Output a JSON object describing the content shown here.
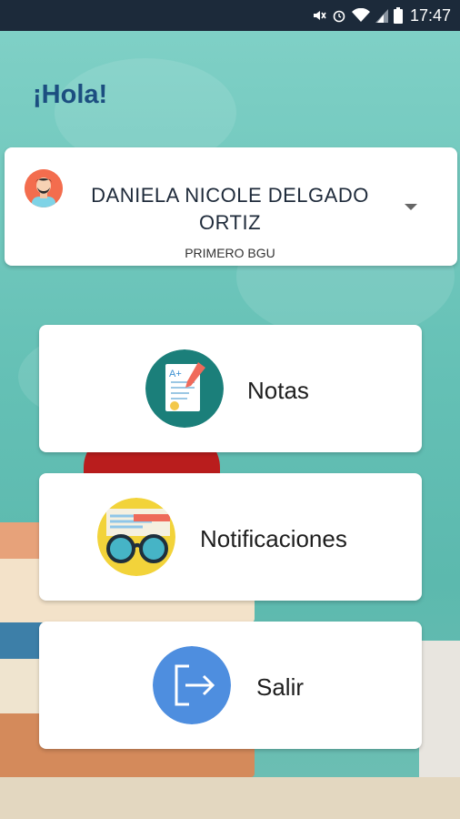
{
  "status_bar": {
    "time": "17:47",
    "icons": [
      "mute-icon",
      "alarm-icon",
      "wifi-icon",
      "signal-icon",
      "battery-icon"
    ]
  },
  "greeting": "¡Hola!",
  "profile": {
    "name": "DANIELA NICOLE DELGADO ORTIZ",
    "grade": "PRIMERO BGU"
  },
  "menu": {
    "grades_label": "Notas",
    "notifications_label": "Notificaciones",
    "logout_label": "Salir"
  },
  "colors": {
    "status_bar": "#1c2a3a",
    "title": "#1c4e80",
    "avatar_bg": "#f36d4e",
    "notas_icon_bg": "#1b7f7a",
    "notif_icon_bg": "#f2d33a",
    "salir_icon_bg": "#4e8edf"
  }
}
